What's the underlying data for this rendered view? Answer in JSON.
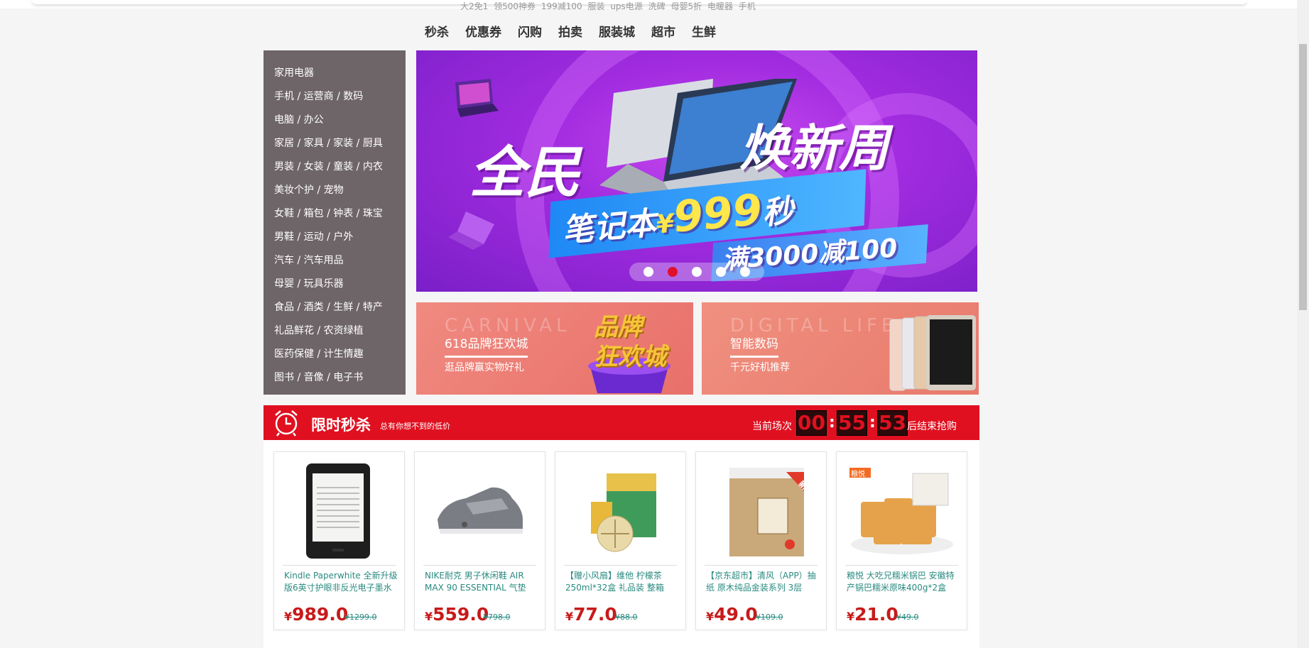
{
  "hotwords": [
    "大2免1",
    "领500神券",
    "199减100",
    "服装",
    "ups电源",
    "洗碑",
    "母婴5折",
    "电暖器",
    "手机"
  ],
  "nav": [
    "秒杀",
    "优惠券",
    "闪购",
    "拍卖",
    "服装城",
    "超市",
    "生鲜"
  ],
  "categories": [
    "家用电器",
    "手机 / 运营商 / 数码",
    "电脑 / 办公",
    "家居 / 家具 / 家装 / 厨具",
    "男装 / 女装 / 童装 / 内衣",
    "美妆个护 / 宠物",
    "女鞋 / 箱包 / 钟表 / 珠宝",
    "男鞋 / 运动 / 户外",
    "汽车 / 汽车用品",
    "母婴 / 玩具乐器",
    "食品 / 酒类 / 生鲜 / 特产",
    "礼品鲜花 / 农资绿植",
    "医药保健 / 计生情趣",
    "图书 / 音像 / 电子书"
  ],
  "banner": {
    "title_left": "全民",
    "title_right": "焕新周",
    "line1_a": "笔记本",
    "line1_b": "¥",
    "line1_c": "999",
    "line1_d": "秒",
    "line2": "满3000减100",
    "active_dot": 1,
    "dot_count": 5
  },
  "promos": [
    {
      "en": "CARNIVAL",
      "title": "618品牌狂欢城",
      "desc": "逛品牌赢实物好礼",
      "deco": "品牌 狂欢城",
      "color": "#ee8078"
    },
    {
      "en": "DIGITAL LIFE",
      "title": "智能数码",
      "desc": "千元好机推荐",
      "color": "#ec7f72"
    }
  ],
  "seckill": {
    "title": "限时秒杀",
    "subtitle": "总有你想不到的低价",
    "round_label": "当前场次",
    "hours": "00",
    "minutes": "55",
    "seconds": "53",
    "after_label": "后结束抢购",
    "sep": ":"
  },
  "products": [
    {
      "name": "Kindle Paperwhite 全新升级版6英寸护眼非反光电子墨水",
      "yen": "¥",
      "price": "989.0",
      "old": "¥1299.0"
    },
    {
      "name": "NIKE耐克 男子休闲鞋 AIR MAX 90 ESSENTIAL 气垫",
      "yen": "¥",
      "price": "559.0",
      "old": "¥798.0"
    },
    {
      "name": "【赠小风扇】维他 柠檬茶250ml*32盒 礼品装 整箱",
      "yen": "¥",
      "price": "77.0",
      "old": "¥88.0"
    },
    {
      "name": "【京东超市】清风（APP）抽纸 原木纯品金装系列 3层",
      "yen": "¥",
      "price": "49.0",
      "old": "¥109.0"
    },
    {
      "name": "粮悦 大吃兄糯米锅巴 安徽特产锅巴糯米原味400g*2盒",
      "yen": "¥",
      "price": "21.0",
      "old": "¥49.0"
    }
  ],
  "product_tags": {
    "fengqing": "新",
    "liangyue": "粮悦"
  }
}
